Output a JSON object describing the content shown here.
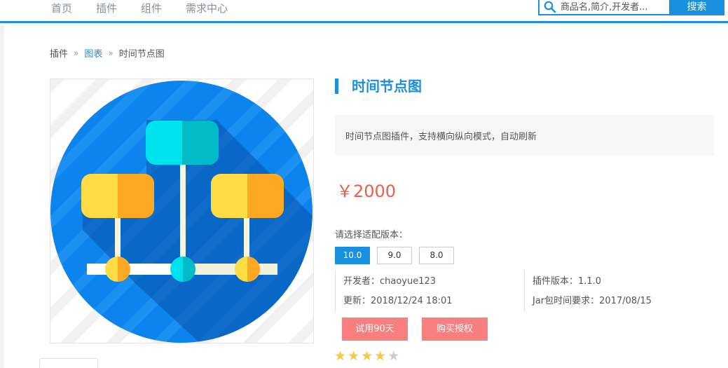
{
  "nav": {
    "items": [
      {
        "label": "首页"
      },
      {
        "label": "插件"
      },
      {
        "label": "组件"
      },
      {
        "label": "需求中心"
      }
    ]
  },
  "search": {
    "placeholder": "商品名,简介,开发者...",
    "button_label": "搜索",
    "icon": "search-icon"
  },
  "breadcrumb": {
    "items": [
      "插件",
      "图表",
      "时间节点图"
    ],
    "separator": "»"
  },
  "product": {
    "image_icon": "timeline-node-chart-icon",
    "title": "时间节点图",
    "description": "时间节点图插件，支持横向纵向模式，自动刷新",
    "price": "￥2000",
    "version_label": "请选择适配版本：",
    "versions": [
      "10.0",
      "9.0",
      "8.0"
    ],
    "selected_version": "10.0",
    "developer": "开发者：chaoyue123",
    "updated": "更新：2018/12/24 18:01",
    "plugin_version": "插件版本：1.1.0",
    "jar_requirement": "Jar包时间要求：2017/08/15",
    "trial_button": "试用90天",
    "buy_button": "购买授权",
    "rating": 4,
    "rating_max": 5
  },
  "colors": {
    "accent": "#1a8fe0",
    "price": "#e8604c",
    "button": "#f77f7f",
    "star_on": "#f6c845",
    "star_off": "#cccccc"
  }
}
